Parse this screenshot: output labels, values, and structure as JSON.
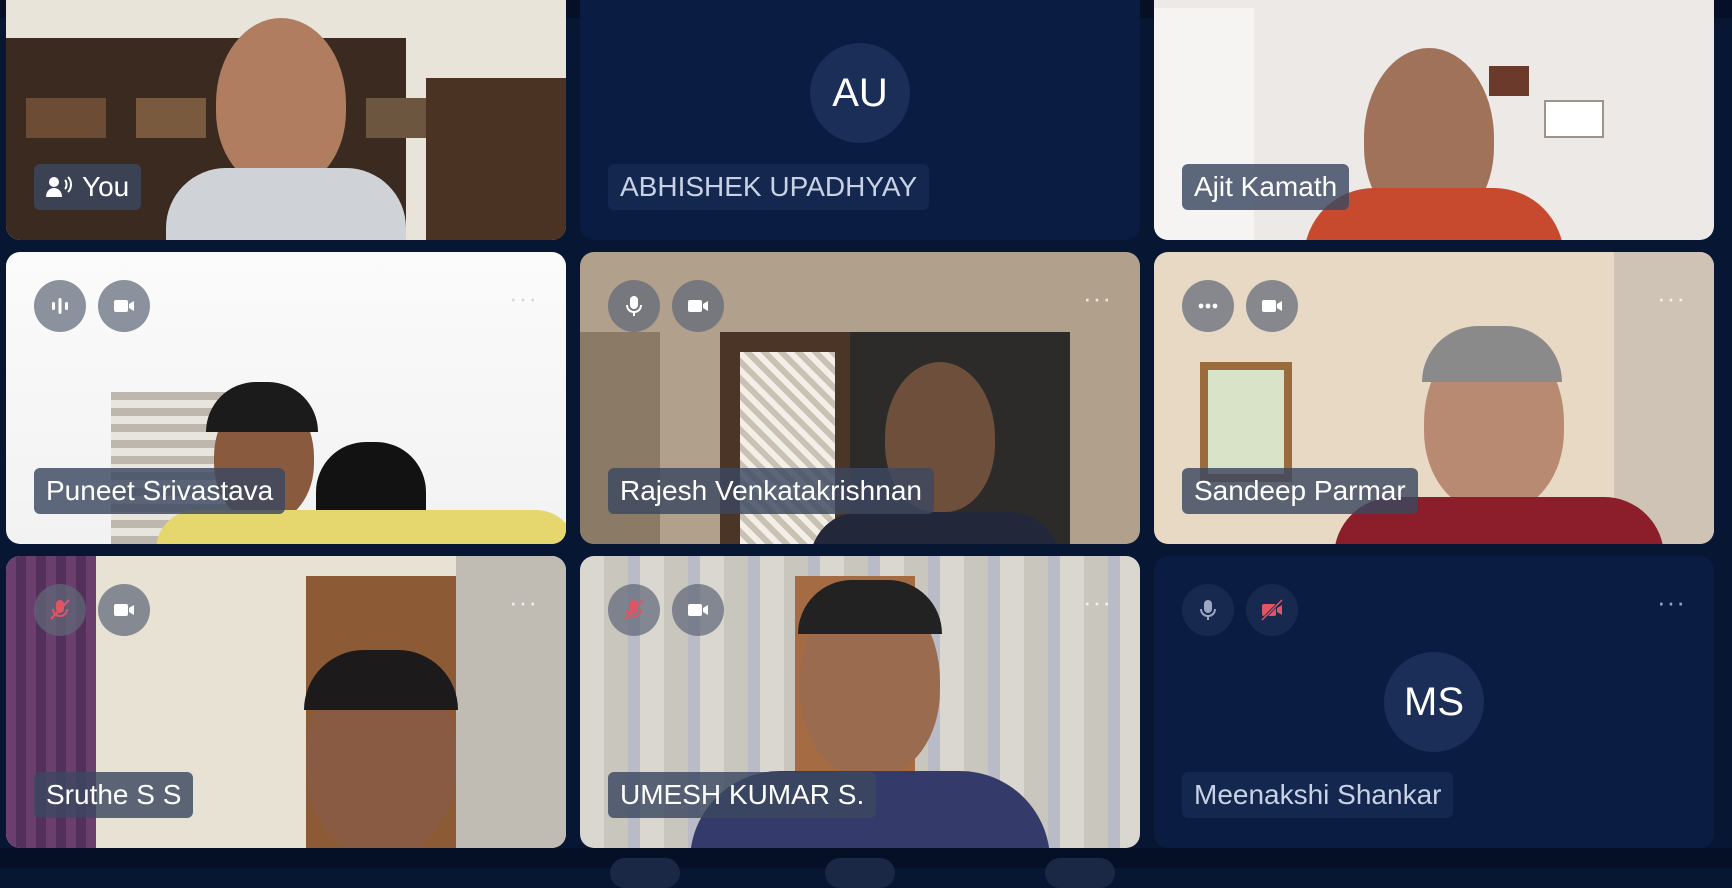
{
  "participants": [
    {
      "name": "You",
      "speaker_icon": "person-speaking-icon"
    },
    {
      "name": "ABHISHEK UPADHYAY",
      "initials": "AU"
    },
    {
      "name": "Ajit Kamath"
    },
    {
      "name": "Puneet Srivastava",
      "more": "···"
    },
    {
      "name": "Rajesh Venkatakrishnan",
      "more": "···"
    },
    {
      "name": "Sandeep Parmar",
      "more": "···"
    },
    {
      "name": "Sruthe S S",
      "more": "···"
    },
    {
      "name": "UMESH KUMAR S.",
      "more": "···"
    },
    {
      "name": "Meenakshi Shankar",
      "initials": "MS",
      "more": "···"
    }
  ],
  "colors": {
    "background": "#071633",
    "avatar_tile": "#0b1c42",
    "muted_red": "#e05563"
  }
}
